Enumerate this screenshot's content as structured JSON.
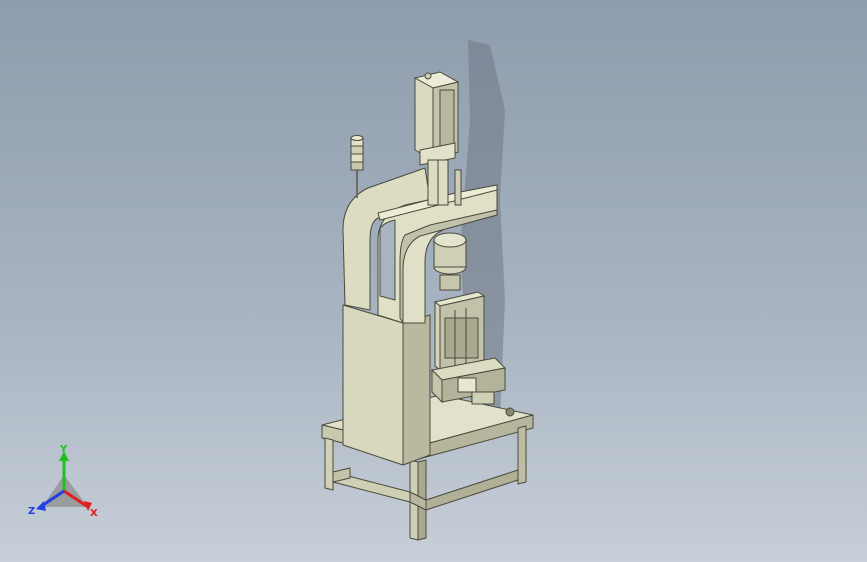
{
  "viewport": {
    "background_top": "#8e9cad",
    "background_bottom": "#c7cfd8",
    "model_color": "#d6d6bd"
  },
  "triad": {
    "x_label": "X",
    "y_label": "Y",
    "z_label": "Z",
    "x_color": "#e02020",
    "y_color": "#20c020",
    "z_color": "#2040e0"
  }
}
